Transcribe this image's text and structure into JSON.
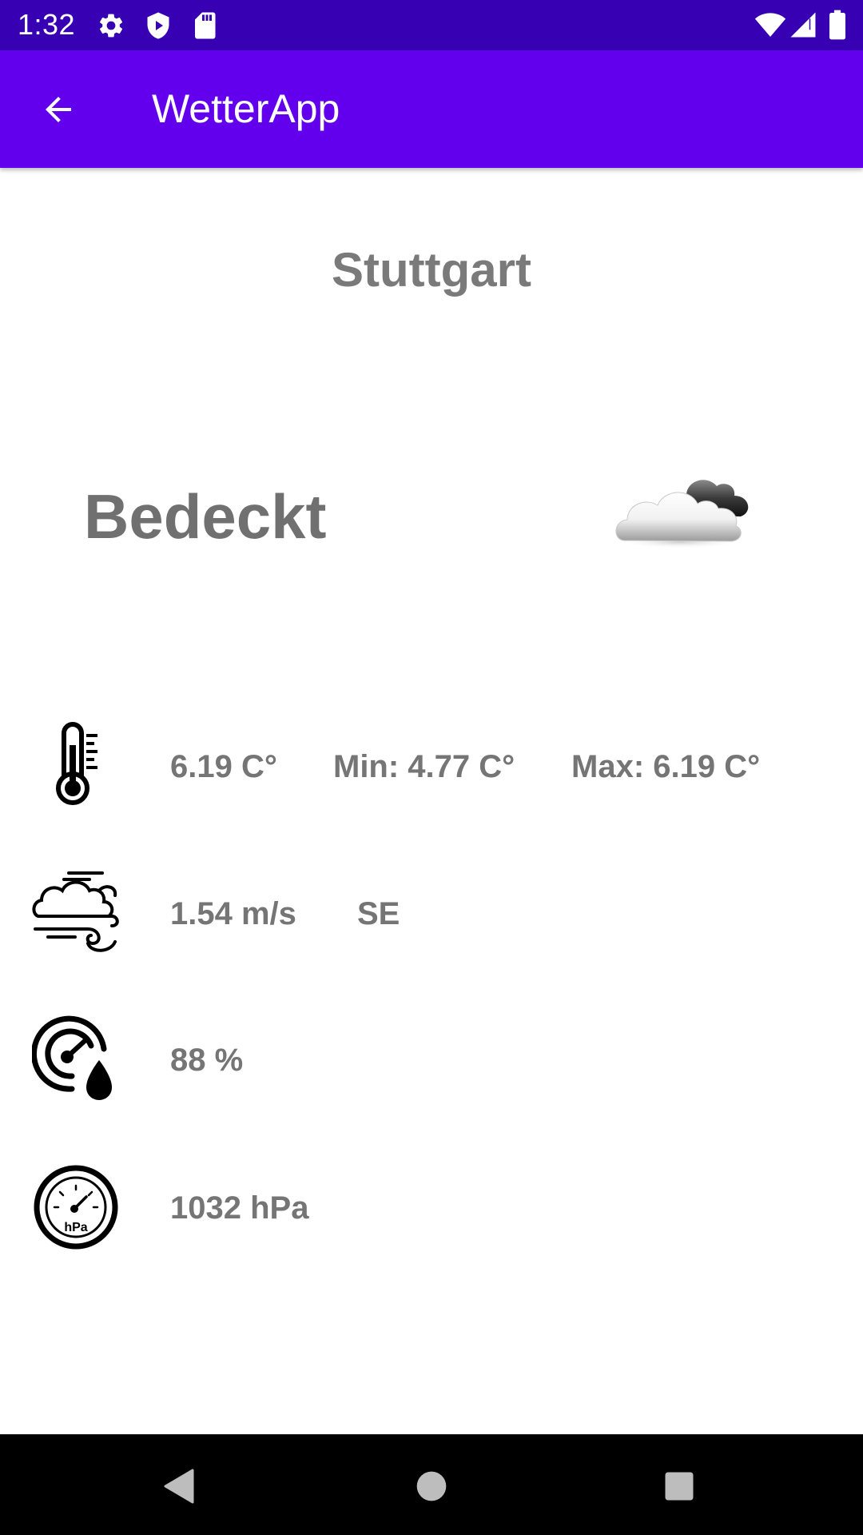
{
  "status_bar": {
    "time": "1:32",
    "left_icons": [
      "gear-icon",
      "shield-play-icon",
      "sd-card-icon"
    ],
    "right_icons": [
      "wifi-icon",
      "cellular-signal-icon",
      "battery-icon"
    ]
  },
  "app_bar": {
    "title": "WetterApp",
    "back_icon": "arrow-back-icon",
    "color": "#6200ee",
    "status_color": "#3700b3"
  },
  "weather": {
    "city": "Stuttgart",
    "condition": "Bedeckt",
    "condition_icon": "overcast-cloud-icon"
  },
  "temperature": {
    "icon": "thermometer-icon",
    "current": "6.19 C°",
    "min": "Min: 4.77 C°",
    "max": "Max: 6.19 C°"
  },
  "wind": {
    "icon": "wind-cloud-icon",
    "speed": "1.54 m/s",
    "direction": "SE"
  },
  "humidity": {
    "icon": "humidity-gauge-icon",
    "value": "88 %"
  },
  "pressure": {
    "icon": "barometer-icon",
    "gauge_label": "hPa",
    "value": "1032 hPa"
  },
  "nav_bar": {
    "buttons": [
      "back-triangle-icon",
      "home-circle-icon",
      "recents-square-icon"
    ]
  }
}
